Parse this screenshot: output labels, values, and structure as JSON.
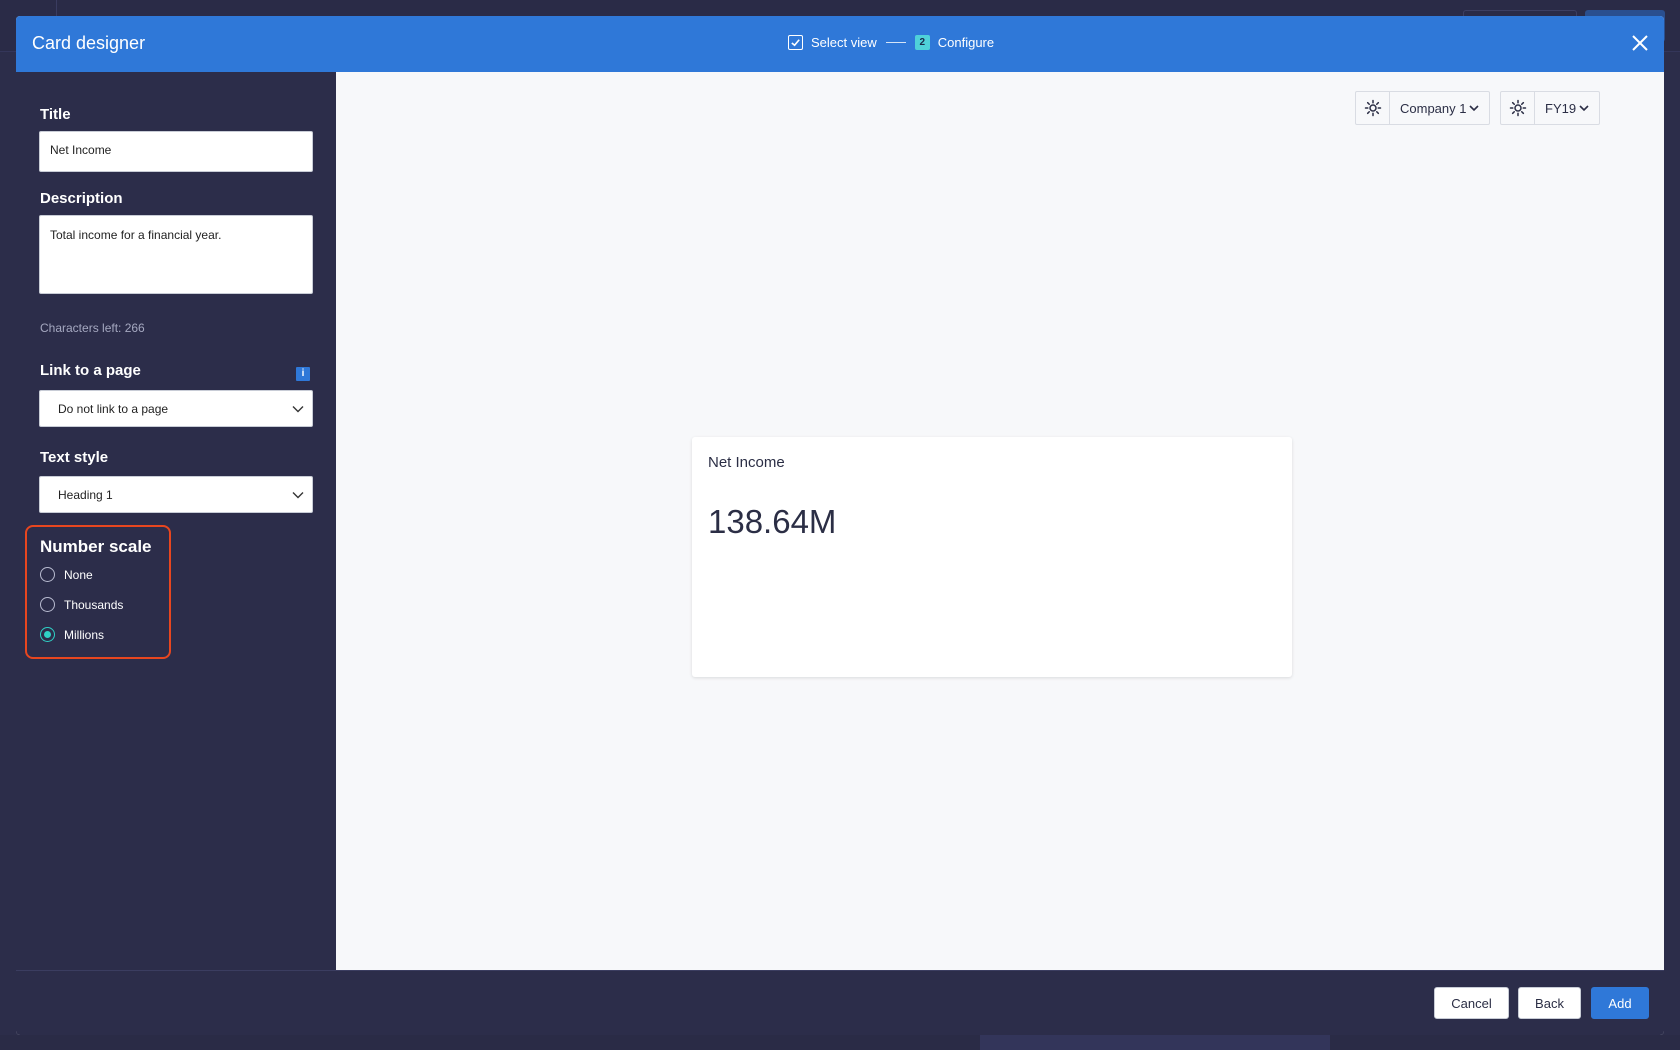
{
  "modal": {
    "title": "Card designer",
    "steps": [
      {
        "label": "Select view",
        "state": "completed"
      },
      {
        "number": "2",
        "label": "Configure",
        "state": "current"
      }
    ]
  },
  "sidebar": {
    "title": {
      "label": "Title",
      "value": "Net Income"
    },
    "description": {
      "label": "Description",
      "value": "Total income for a financial year.",
      "chars_left": "Characters left: 266"
    },
    "link": {
      "label": "Link to a page",
      "value": "Do not link to a page",
      "info_icon": "i"
    },
    "text_style": {
      "label": "Text style",
      "value": "Heading 1"
    },
    "number_scale": {
      "label": "Number scale",
      "options": [
        {
          "label": "None",
          "checked": false
        },
        {
          "label": "Thousands",
          "checked": false
        },
        {
          "label": "Millions",
          "checked": true
        }
      ]
    }
  },
  "preview": {
    "filters": [
      {
        "value": "Company 1"
      },
      {
        "value": "FY19"
      }
    ],
    "card": {
      "title": "Net Income",
      "value": "138.64M"
    }
  },
  "footer": {
    "cancel_label": "Cancel",
    "back_label": "Back",
    "add_label": "Add"
  },
  "colors": {
    "header": "#2f78d8",
    "sidebar": "#2c2d4a",
    "highlight": "#e8461f",
    "radio_checked": "#2fd1c5"
  }
}
